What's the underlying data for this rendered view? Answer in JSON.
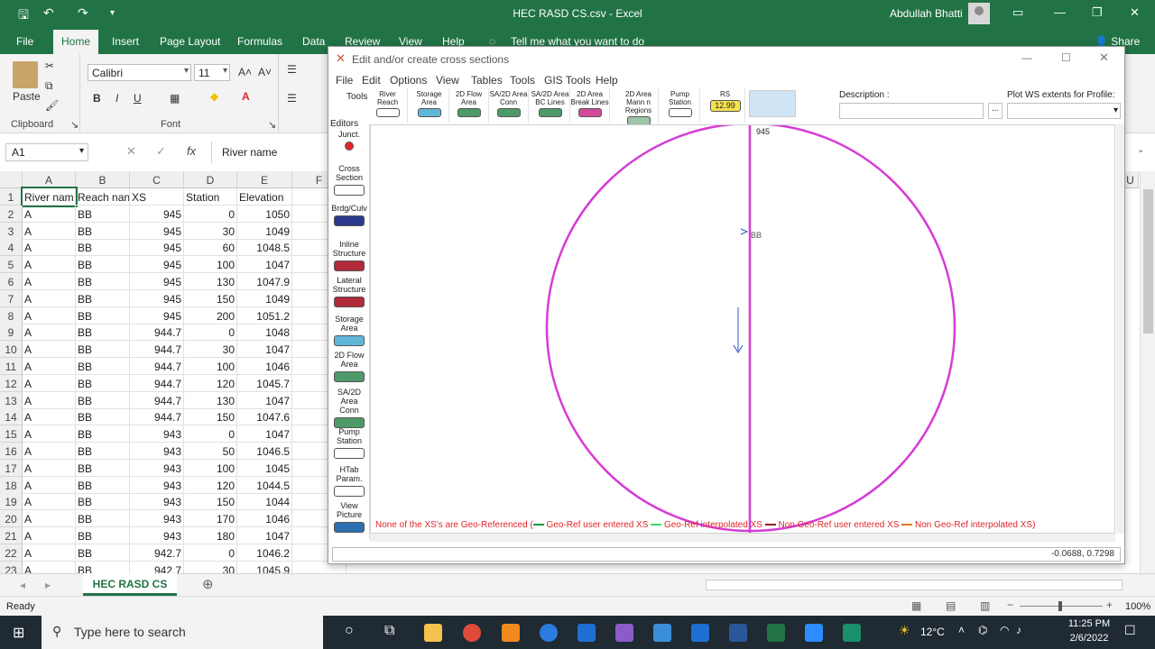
{
  "excel": {
    "title": "HEC RASD CS.csv  -  Excel",
    "user": "Abdullah Bhatti",
    "tabs": [
      "File",
      "Home",
      "Insert",
      "Page Layout",
      "Formulas",
      "Data",
      "Review",
      "View",
      "Help"
    ],
    "tell_me": "Tell me what you want to do",
    "share": "Share",
    "ribbon": {
      "paste": "Paste",
      "clipboard": "Clipboard",
      "font_label": "Font",
      "font_name": "Calibri",
      "font_size": "11",
      "bold": "B",
      "italic": "I",
      "underline": "U"
    },
    "name_box": "A1",
    "formula": "River name",
    "columns": [
      "A",
      "B",
      "C",
      "D",
      "E",
      "F"
    ],
    "extra_column": "U",
    "rows": [
      [
        "River nam",
        "Reach nan",
        "XS",
        "Station",
        "Elevation"
      ],
      [
        "A",
        "BB",
        "945",
        "0",
        "1050"
      ],
      [
        "A",
        "BB",
        "945",
        "30",
        "1049"
      ],
      [
        "A",
        "BB",
        "945",
        "60",
        "1048.5"
      ],
      [
        "A",
        "BB",
        "945",
        "100",
        "1047"
      ],
      [
        "A",
        "BB",
        "945",
        "130",
        "1047.9"
      ],
      [
        "A",
        "BB",
        "945",
        "150",
        "1049"
      ],
      [
        "A",
        "BB",
        "945",
        "200",
        "1051.2"
      ],
      [
        "A",
        "BB",
        "944.7",
        "0",
        "1048"
      ],
      [
        "A",
        "BB",
        "944.7",
        "30",
        "1047"
      ],
      [
        "A",
        "BB",
        "944.7",
        "100",
        "1046"
      ],
      [
        "A",
        "BB",
        "944.7",
        "120",
        "1045.7"
      ],
      [
        "A",
        "BB",
        "944.7",
        "130",
        "1047"
      ],
      [
        "A",
        "BB",
        "944.7",
        "150",
        "1047.6"
      ],
      [
        "A",
        "BB",
        "943",
        "0",
        "1047"
      ],
      [
        "A",
        "BB",
        "943",
        "50",
        "1046.5"
      ],
      [
        "A",
        "BB",
        "943",
        "100",
        "1045"
      ],
      [
        "A",
        "BB",
        "943",
        "120",
        "1044.5"
      ],
      [
        "A",
        "BB",
        "943",
        "150",
        "1044"
      ],
      [
        "A",
        "BB",
        "943",
        "170",
        "1046"
      ],
      [
        "A",
        "BB",
        "943",
        "180",
        "1047"
      ],
      [
        "A",
        "BB",
        "942.7",
        "0",
        "1046.2"
      ],
      [
        "A",
        "BB",
        "942.7",
        "30",
        "1045.9"
      ]
    ],
    "row_numbers": [
      "1",
      "2",
      "3",
      "4",
      "5",
      "6",
      "7",
      "8",
      "9",
      "10",
      "11",
      "12",
      "13",
      "14",
      "15",
      "16",
      "17",
      "18",
      "19",
      "20",
      "21",
      "22",
      "23"
    ],
    "sheet_tab": "HEC RASD CS",
    "status": "Ready",
    "zoom": "100%"
  },
  "hec": {
    "title": "Edit and/or create cross sections",
    "menu": [
      "File",
      "Edit",
      "Options",
      "View",
      "Tables",
      "Tools",
      "GIS Tools",
      "Help"
    ],
    "toolbar": [
      {
        "label": "River Reach",
        "color": "#ffffff"
      },
      {
        "label": "Storage Area",
        "color": "#5fb7d8"
      },
      {
        "label": "2D Flow Area",
        "color": "#4e9a6a"
      },
      {
        "label": "SA/2D Area Conn",
        "color": "#4e9a6a"
      },
      {
        "label": "SA/2D Area BC Lines",
        "color": "#4e9a6a"
      },
      {
        "label": "2D Area Break Lines",
        "color": "#d14b9a"
      },
      {
        "label": "2D Area Mann n Regions",
        "color": "#9fc5a8"
      },
      {
        "label": "Pump Station",
        "color": "#ffffff"
      },
      {
        "label": "RS",
        "color": "#f5e14a"
      }
    ],
    "rs_value": "12.99",
    "tools_label": "Tools",
    "editors_label": "Editors",
    "description_label": "Description :",
    "plot_ws_label": "Plot WS extents for Profile:",
    "editors": [
      {
        "label": "Junct.",
        "color": "#e0262b"
      },
      {
        "label": "Cross Section",
        "color": "#ffffff"
      },
      {
        "label": "Brdg/Culv",
        "color": "#2b3a8c"
      },
      {
        "label": "Inline Structure",
        "color": "#b02a3a"
      },
      {
        "label": "Lateral Structure",
        "color": "#b02a3a"
      },
      {
        "label": "Storage Area",
        "color": "#5fb7d8"
      },
      {
        "label": "2D Flow Area",
        "color": "#4e9a6a"
      },
      {
        "label": "SA/2D Area Conn",
        "color": "#4e9a6a"
      },
      {
        "label": "Pump Station",
        "color": "#ffffff"
      },
      {
        "label": "HTab Param.",
        "color": "#ffffff"
      },
      {
        "label": "View Picture",
        "color": "#2b6fb0"
      }
    ],
    "xs_label": "945",
    "reach_label": "BB",
    "legend": {
      "part1": "None of the XS's are Geo-Referenced (",
      "part2": " Geo-Ref user entered XS",
      "part3": " Geo-Ref interpolated XS",
      "part4": " Non Geo-Ref user entered XS",
      "part5": " Non Geo-Ref interpolated XS)"
    },
    "coords": "-0.0688, 0.7298"
  },
  "taskbar": {
    "search_placeholder": "Type here to search",
    "temperature": "12°C",
    "time": "11:25 PM",
    "date": "2/6/2022"
  },
  "colors": {
    "excel_green": "#217346",
    "circle": "#d63bd6",
    "legend_red": "#e0262b",
    "legend_green": "#1a9c3a"
  }
}
